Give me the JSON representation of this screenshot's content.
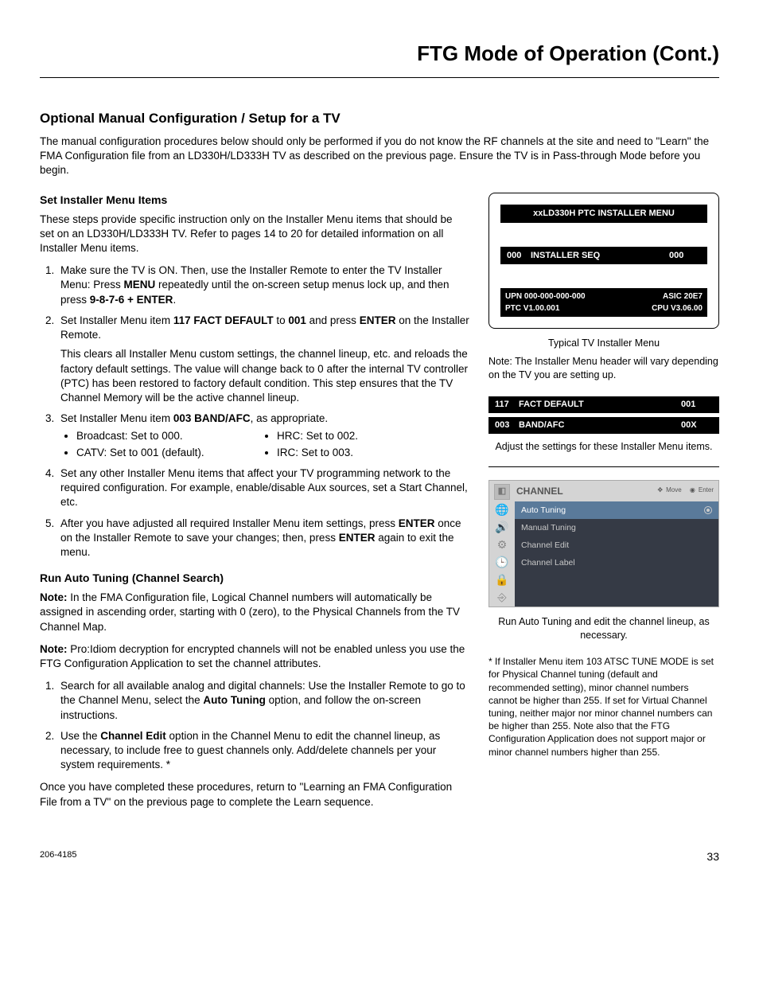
{
  "page_title": "FTG Mode of Operation (Cont.)",
  "section_title": "Optional Manual Configuration / Setup for a TV",
  "intro": "The manual configuration procedures below should only be performed if you do not know the RF channels at the site and need to \"Learn\" the FMA Configuration file from an LD330H/LD333H TV as described on the previous page. Ensure the TV is in Pass-through Mode before you begin.",
  "set_installer": {
    "title": "Set Installer Menu Items",
    "para": "These steps provide specific instruction only on the Installer Menu items that should be set on an LD330H/LD333H TV. Refer to pages 14 to 20 for detailed information on all Installer Menu items.",
    "step1_a": "Make sure the TV is ON. Then, use the Installer Remote to enter the TV Installer Menu: Press ",
    "step1_menu": "MENU",
    "step1_b": " repeatedly until the on-screen setup menus lock up, and then press ",
    "step1_keys": "9-8-7-6 + ENTER",
    "step1_c": ".",
    "step2_a": "Set Installer Menu item ",
    "step2_item": "117 FACT DEFAULT",
    "step2_b": " to ",
    "step2_val": "001",
    "step2_c": " and press ",
    "step2_enter": "ENTER",
    "step2_d": " on the Installer Remote.",
    "step2_para": "This clears all Installer Menu custom settings, the channel lineup, etc. and reloads the factory default settings. The value will change back to 0 after the internal TV controller (PTC) has been restored to factory default condition. This step ensures that the TV Channel Memory will be the active channel lineup.",
    "step3_a": "Set Installer Menu item ",
    "step3_item": "003 BAND/AFC",
    "step3_b": ", as appropriate.",
    "step3_bullets": [
      "Broadcast: Set to 000.",
      "HRC: Set to 002.",
      "CATV: Set to 001 (default).",
      "IRC: Set to 003."
    ],
    "step4": "Set any other Installer Menu items that affect your TV programming network to the required configuration. For example, enable/disable Aux sources, set a Start Channel, etc.",
    "step5_a": "After you have adjusted all required Installer Menu item settings, press ",
    "step5_enter1": "ENTER",
    "step5_b": " once on the Installer Remote to save your changes; then, press ",
    "step5_enter2": "ENTER",
    "step5_c": " again to exit the menu."
  },
  "auto_tuning": {
    "title": "Run Auto Tuning (Channel Search)",
    "note1_label": "Note:",
    "note1": " In the FMA Configuration file, Logical Channel numbers will automatically be assigned in ascending order, starting with 0 (zero), to the Physical Channels from the TV Channel Map.",
    "note2_label": "Note:",
    "note2": " Pro:Idiom decryption for encrypted channels will not be enabled unless you use the FTG Configuration Application to set the channel attributes.",
    "step1_a": "Search for all available analog and digital channels: Use the Installer Remote to go to the Channel Menu, select the ",
    "step1_bold": "Auto Tuning",
    "step1_b": " option, and follow the on-screen instructions.",
    "step2_a": "Use the ",
    "step2_bold": "Channel Edit",
    "step2_b": " option in the Channel Menu to edit the channel lineup, as necessary, to include free to guest channels only. Add/delete channels per your system requirements. *",
    "closing": "Once you have completed these procedures, return to \"Learning an FMA Configuration File from a TV\" on the previous page to complete the Learn sequence."
  },
  "installer_menu": {
    "header": "xxLD330H  PTC  INSTALLER  MENU",
    "row_code": "000",
    "row_label": "INSTALLER SEQ",
    "row_val": "000",
    "upn_label": "UPN  000-000-000-000",
    "asic": "ASIC  20E7",
    "ptc": "PTC  V1.00.001",
    "cpu": "CPU  V3.06.00",
    "caption": "Typical TV Installer Menu",
    "note": "Note: The Installer Menu header will vary depending on the TV you are setting up."
  },
  "setting_bars": [
    {
      "code": "117",
      "label": "FACT DEFAULT",
      "val": "001"
    },
    {
      "code": "003",
      "label": "BAND/AFC",
      "val": "00X"
    }
  ],
  "setting_caption": "Adjust the settings for these Installer Menu items.",
  "channel_osd": {
    "title": "CHANNEL",
    "hint_move": "Move",
    "hint_enter": "Enter",
    "rows": [
      {
        "label": "Auto Tuning",
        "selected": true
      },
      {
        "label": "Manual Tuning",
        "selected": false
      },
      {
        "label": "Channel Edit",
        "selected": false
      },
      {
        "label": "Channel Label",
        "selected": false
      }
    ],
    "caption": "Run Auto Tuning and edit the channel lineup, as necessary."
  },
  "footnote": "* If Installer Menu item 103 ATSC TUNE MODE is set for Physical Channel tuning (default and recommended setting), minor channel numbers cannot be higher than 255. If set for Virtual Channel tuning, neither major nor minor channel numbers can be higher than 255. Note also that the FTG Configuration Application does not support major or minor channel numbers higher than 255.",
  "footer": {
    "doc_id": "206-4185",
    "page": "33"
  }
}
